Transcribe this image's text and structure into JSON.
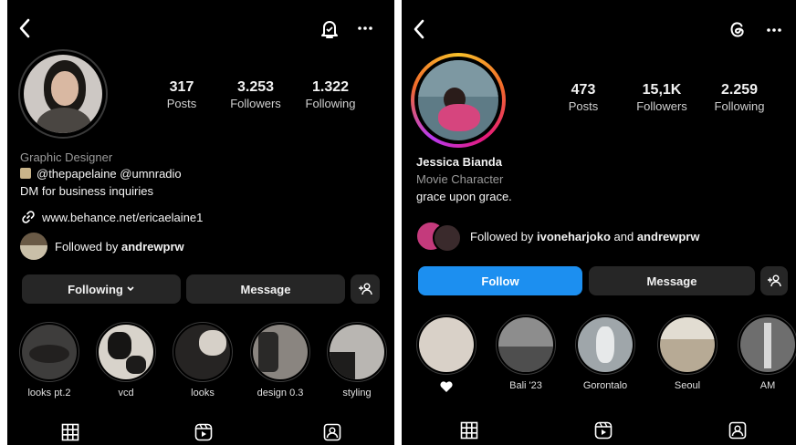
{
  "left": {
    "stats": {
      "posts_value": "317",
      "posts_label": "Posts",
      "followers_value": "3.253",
      "followers_label": "Followers",
      "following_value": "1.322",
      "following_label": "Following"
    },
    "bio": {
      "category": "Graphic Designer",
      "line2": "@thepapelaine @umnradio",
      "line3": "DM for business inquiries",
      "link": "www.behance.net/ericaelaine1",
      "followed_prefix": "Followed by ",
      "followed_user": "andrewprw"
    },
    "buttons": {
      "following": "Following",
      "message": "Message"
    },
    "highlights": [
      {
        "label": "looks pt.2"
      },
      {
        "label": "vcd"
      },
      {
        "label": "looks"
      },
      {
        "label": "design 0.3"
      },
      {
        "label": "styling"
      }
    ]
  },
  "right": {
    "stats": {
      "posts_value": "473",
      "posts_label": "Posts",
      "followers_value": "15,1K",
      "followers_label": "Followers",
      "following_value": "2.259",
      "following_label": "Following"
    },
    "bio": {
      "name": "Jessica Bianda",
      "category": "Movie Character",
      "tagline": "grace upon grace.",
      "followed_prefix": "Followed by ",
      "followed_user1": "ivoneharjoko",
      "followed_and": " and ",
      "followed_user2": "andrewprw"
    },
    "buttons": {
      "follow": "Follow",
      "message": "Message"
    },
    "highlights": [
      {
        "label": ""
      },
      {
        "label": "Bali '23"
      },
      {
        "label": "Gorontalo"
      },
      {
        "label": "Seoul"
      },
      {
        "label": "AM"
      }
    ]
  },
  "colors": {
    "background": "#000000",
    "button": "#262626",
    "follow_button": "#1c8ff0",
    "text": "#f5f5f5",
    "muted": "#9a9a9a"
  },
  "icons": [
    "back-icon",
    "notification-bell-icon",
    "more-icon",
    "threads-icon",
    "add-person-icon",
    "link-icon",
    "grid-icon",
    "reels-icon",
    "tagged-icon",
    "heart-icon"
  ]
}
